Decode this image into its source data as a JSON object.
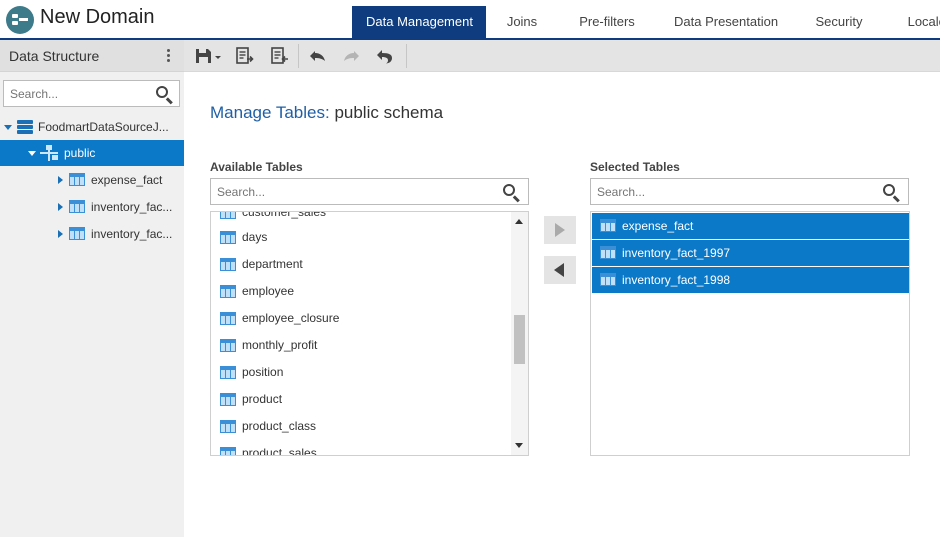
{
  "app": {
    "title": "New Domain"
  },
  "tabs": [
    {
      "label": "Data Management",
      "active": true
    },
    {
      "label": "Joins",
      "active": false
    },
    {
      "label": "Pre-filters",
      "active": false
    },
    {
      "label": "Data Presentation",
      "active": false
    },
    {
      "label": "Security",
      "active": false
    },
    {
      "label": "Locales",
      "active": false
    }
  ],
  "sidebar": {
    "title": "Data Structure",
    "search_placeholder": "Search...",
    "tree": {
      "datasource": "FoodmartDataSourceJ...",
      "schema": "public",
      "tables": [
        "expense_fact",
        "inventory_fac...",
        "inventory_fac..."
      ]
    }
  },
  "toolbar": {
    "icons": [
      "save-icon",
      "export-icon",
      "import-icon",
      "undo-icon",
      "redo-icon",
      "undo-all-icon"
    ]
  },
  "main": {
    "title_accent": "Manage Tables:",
    "title_rest": " public schema",
    "available": {
      "label": "Available Tables",
      "search_placeholder": "Search...",
      "partial_top": "customer_sales",
      "items": [
        "days",
        "department",
        "employee",
        "employee_closure",
        "monthly_profit",
        "position",
        "product",
        "product_class"
      ],
      "partial_bottom": "product_sales"
    },
    "selected": {
      "label": "Selected Tables",
      "search_placeholder": "Search...",
      "items": [
        "expense_fact",
        "inventory_fact_1997",
        "inventory_fact_1998"
      ]
    }
  },
  "colors": {
    "brand_dark": "#0e3c7e",
    "selection": "#0b79c8",
    "accent_text": "#1f5fa5"
  }
}
